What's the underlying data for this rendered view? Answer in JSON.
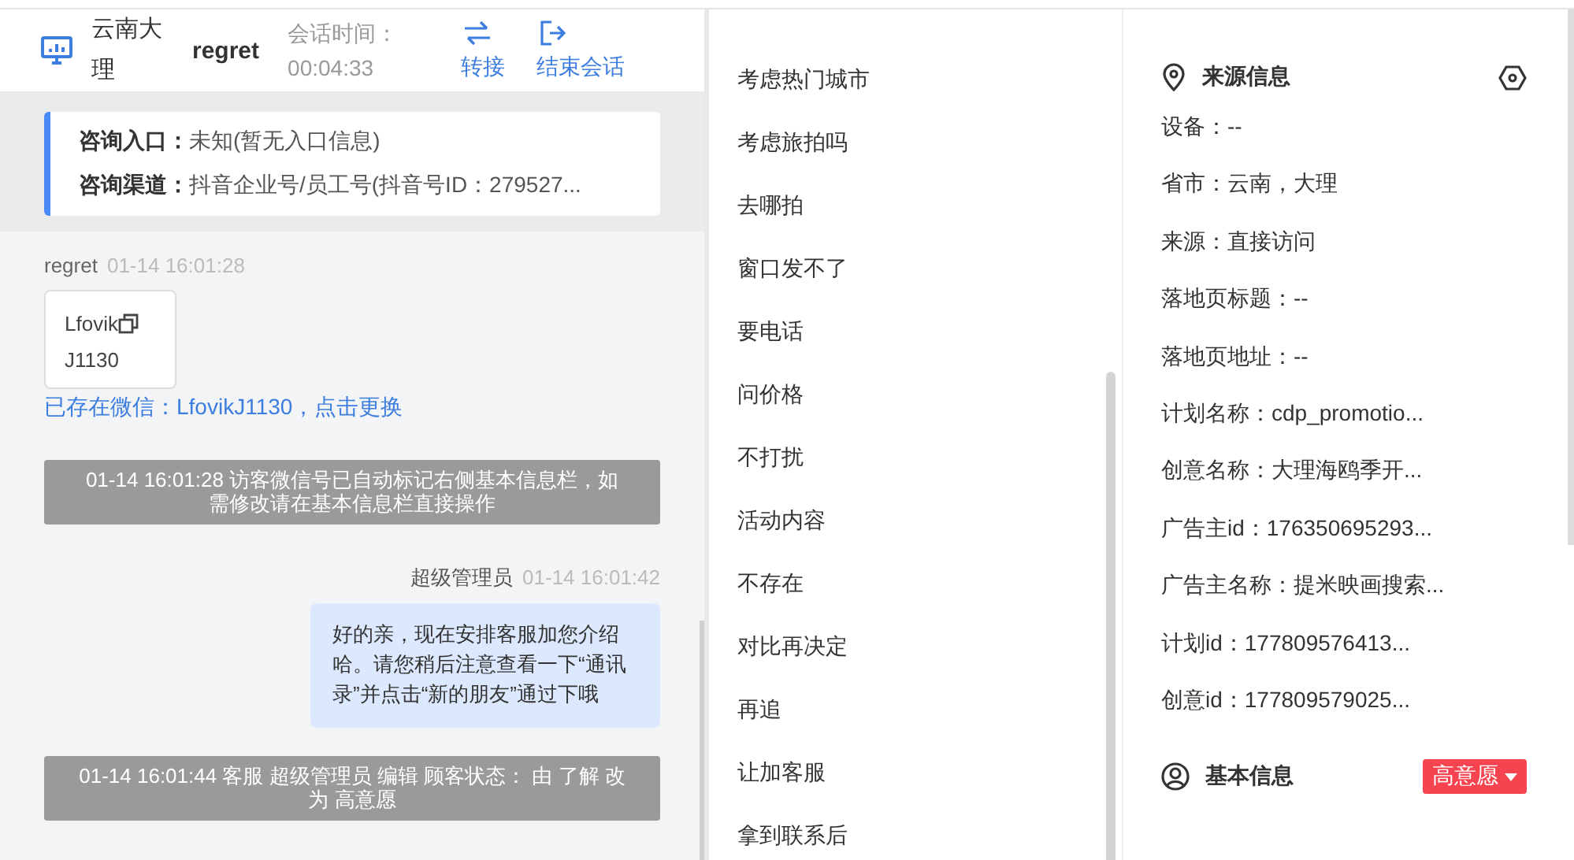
{
  "chat_header": {
    "location": "云南大理",
    "visitor": "regret",
    "duration_label": "会话时间：",
    "duration": "00:04:33",
    "actions": [
      {
        "kind": "transfer",
        "label": "转接"
      },
      {
        "kind": "end",
        "label": "结束会话"
      }
    ]
  },
  "consult_info": [
    {
      "label": "咨询入口：",
      "value": "未知(暂无入口信息)"
    },
    {
      "label": "咨询渠道：",
      "value": "抖音企业号/员工号(抖音号ID：279527..."
    }
  ],
  "messages": [
    {
      "kind": "visitor",
      "sender": "regret",
      "time": "01-14 16:01:28",
      "card_text": "Lfovik",
      "card_text_2": "J1130"
    },
    {
      "kind": "link",
      "text": "已存在微信：LfovikJ1130，点击更换"
    },
    {
      "kind": "system",
      "text": "01-14 16:01:28 访客微信号已自动标记右侧基本信息栏，如需修改请在基本信息栏直接操作"
    },
    {
      "kind": "agent",
      "sender": "超级管理员",
      "time": "01-14 16:01:42",
      "text": "好的亲，现在安排客服加您介绍哈。请您稍后注意查看一下“通讯录”并点击“新的朋友”通过下哦"
    },
    {
      "kind": "system",
      "text": "01-14 16:01:44 客服 超级管理员 编辑 顾客状态： 由 了解 改为 高意愿"
    }
  ],
  "quick_replies": [
    "考虑热门城市",
    "考虑旅拍吗",
    "去哪拍",
    "窗口发不了",
    "要电话",
    "问价格",
    "不打扰",
    "活动内容",
    "不存在",
    "对比再决定",
    "再追",
    "让加客服",
    "拿到联系后"
  ],
  "source_info": {
    "title": "来源信息",
    "rows": [
      "设备：--",
      "省市：云南，大理",
      "来源：直接访问",
      "落地页标题：--",
      "落地页地址：--",
      "计划名称：cdp_promotio...",
      "创意名称：大理海鸥季开...",
      "广告主id：176350695293...",
      "广告主名称：提米映画搜索...",
      "计划id：177809576413...",
      "创意id：177809579025..."
    ]
  },
  "basic_info": {
    "title": "基本信息",
    "intent_tag": "高意愿"
  }
}
